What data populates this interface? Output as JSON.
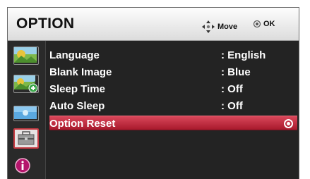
{
  "header": {
    "title": "OPTION",
    "move_hint": "Move",
    "ok_hint": "OK"
  },
  "sidebar": {
    "icons": [
      {
        "icon": "picture-icon",
        "active": false
      },
      {
        "icon": "picture-add-icon",
        "active": false
      },
      {
        "icon": "screen-icon",
        "active": false
      },
      {
        "icon": "toolbox-icon",
        "active": true
      },
      {
        "icon": "info-icon",
        "active": false
      }
    ]
  },
  "menu": {
    "items": [
      {
        "label": "Language",
        "value": ": English",
        "selected": false
      },
      {
        "label": "Blank Image",
        "value": ": Blue",
        "selected": false
      },
      {
        "label": "Sleep Time",
        "value": ": Off",
        "selected": false
      },
      {
        "label": "Auto Sleep",
        "value": ": Off",
        "selected": false
      },
      {
        "label": "Option Reset",
        "value": "",
        "selected": true
      }
    ]
  },
  "colors": {
    "panel_bg": "#232323",
    "header_bg": "#ebebeb",
    "selection": "#c02a3e",
    "text": "#ffffff"
  }
}
